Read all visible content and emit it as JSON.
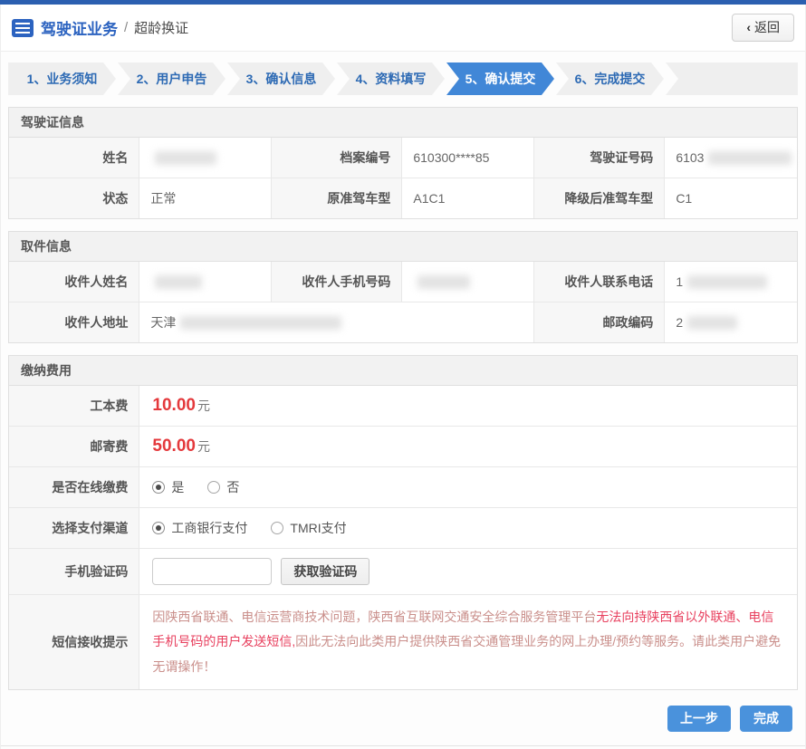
{
  "header": {
    "app_title": "驾驶证业务",
    "separator": "/",
    "page_title": "超龄换证",
    "back_label": "返回",
    "back_icon": "chevron-left-icon",
    "list_icon": "list-icon"
  },
  "steps": {
    "items": [
      {
        "label": "1、业务须知",
        "active": false
      },
      {
        "label": "2、用户申告",
        "active": false
      },
      {
        "label": "3、确认信息",
        "active": false
      },
      {
        "label": "4、资料填写",
        "active": false
      },
      {
        "label": "5、确认提交",
        "active": true
      },
      {
        "label": "6、完成提交",
        "active": false
      }
    ]
  },
  "license_info": {
    "title": "驾驶证信息",
    "rows": [
      [
        {
          "label": "姓名",
          "value": "",
          "blur": 68
        },
        {
          "label": "档案编号",
          "value": "610300****85"
        },
        {
          "label": "驾驶证号码",
          "value": "6103",
          "blur": 92
        }
      ],
      [
        {
          "label": "状态",
          "value": "正常"
        },
        {
          "label": "原准驾车型",
          "value": "A1C1"
        },
        {
          "label": "降级后准驾车型",
          "value": "C1"
        }
      ]
    ]
  },
  "pickup_info": {
    "title": "取件信息",
    "rows": [
      [
        {
          "label": "收件人姓名",
          "value": "",
          "blur": 52
        },
        {
          "label": "收件人手机号码",
          "value": "",
          "blur": 58
        },
        {
          "label": "收件人联系电话",
          "value": "1",
          "blur": 88
        }
      ],
      [
        {
          "label": "收件人地址",
          "value": "天津",
          "blur": 178,
          "wide": true
        },
        {
          "label": "邮政编码",
          "value": "2",
          "blur": 55
        }
      ]
    ]
  },
  "fees": {
    "title": "缴纳费用",
    "production_fee": {
      "label": "工本费",
      "amount": "10.00",
      "unit": "元"
    },
    "mailing_fee": {
      "label": "邮寄费",
      "amount": "50.00",
      "unit": "元"
    },
    "online_payment": {
      "label": "是否在线缴费",
      "options": [
        {
          "label": "是",
          "selected": true
        },
        {
          "label": "否",
          "selected": false
        }
      ]
    },
    "payment_channel": {
      "label": "选择支付渠道",
      "options": [
        {
          "label": "工商银行支付",
          "selected": true
        },
        {
          "label": "TMRI支付",
          "selected": false
        }
      ]
    },
    "verification": {
      "label": "手机验证码",
      "input_value": "",
      "button_label": "获取验证码"
    },
    "sms_notice": {
      "label": "短信接收提示",
      "segments": [
        {
          "text": "因陕西省联通、电信运营商技术问题，陕西省互联网交通安全综合服务管理平台",
          "emphasis": false
        },
        {
          "text": "无法向持陕西省以外联通、电信手机号码的用户发送短信,",
          "emphasis": true
        },
        {
          "text": "因此无法向此类用户提供陕西省交通管理业务的网上办理/预约等服务。请此类用户避免无谓操作！",
          "emphasis": false
        }
      ]
    }
  },
  "footer": {
    "prev_label": "上一步",
    "finish_label": "完成"
  },
  "colors": {
    "top_bar": "#2b5fb0",
    "brand_blue": "#2c63c0",
    "step_text_blue": "#2d6ab4",
    "step_active_bg": "#4187d7",
    "fee_red": "#e4393c",
    "notice_soft_red": "#ca8f8b",
    "notice_strong_red": "#e8415f",
    "button_blue": "#4a92dc"
  }
}
